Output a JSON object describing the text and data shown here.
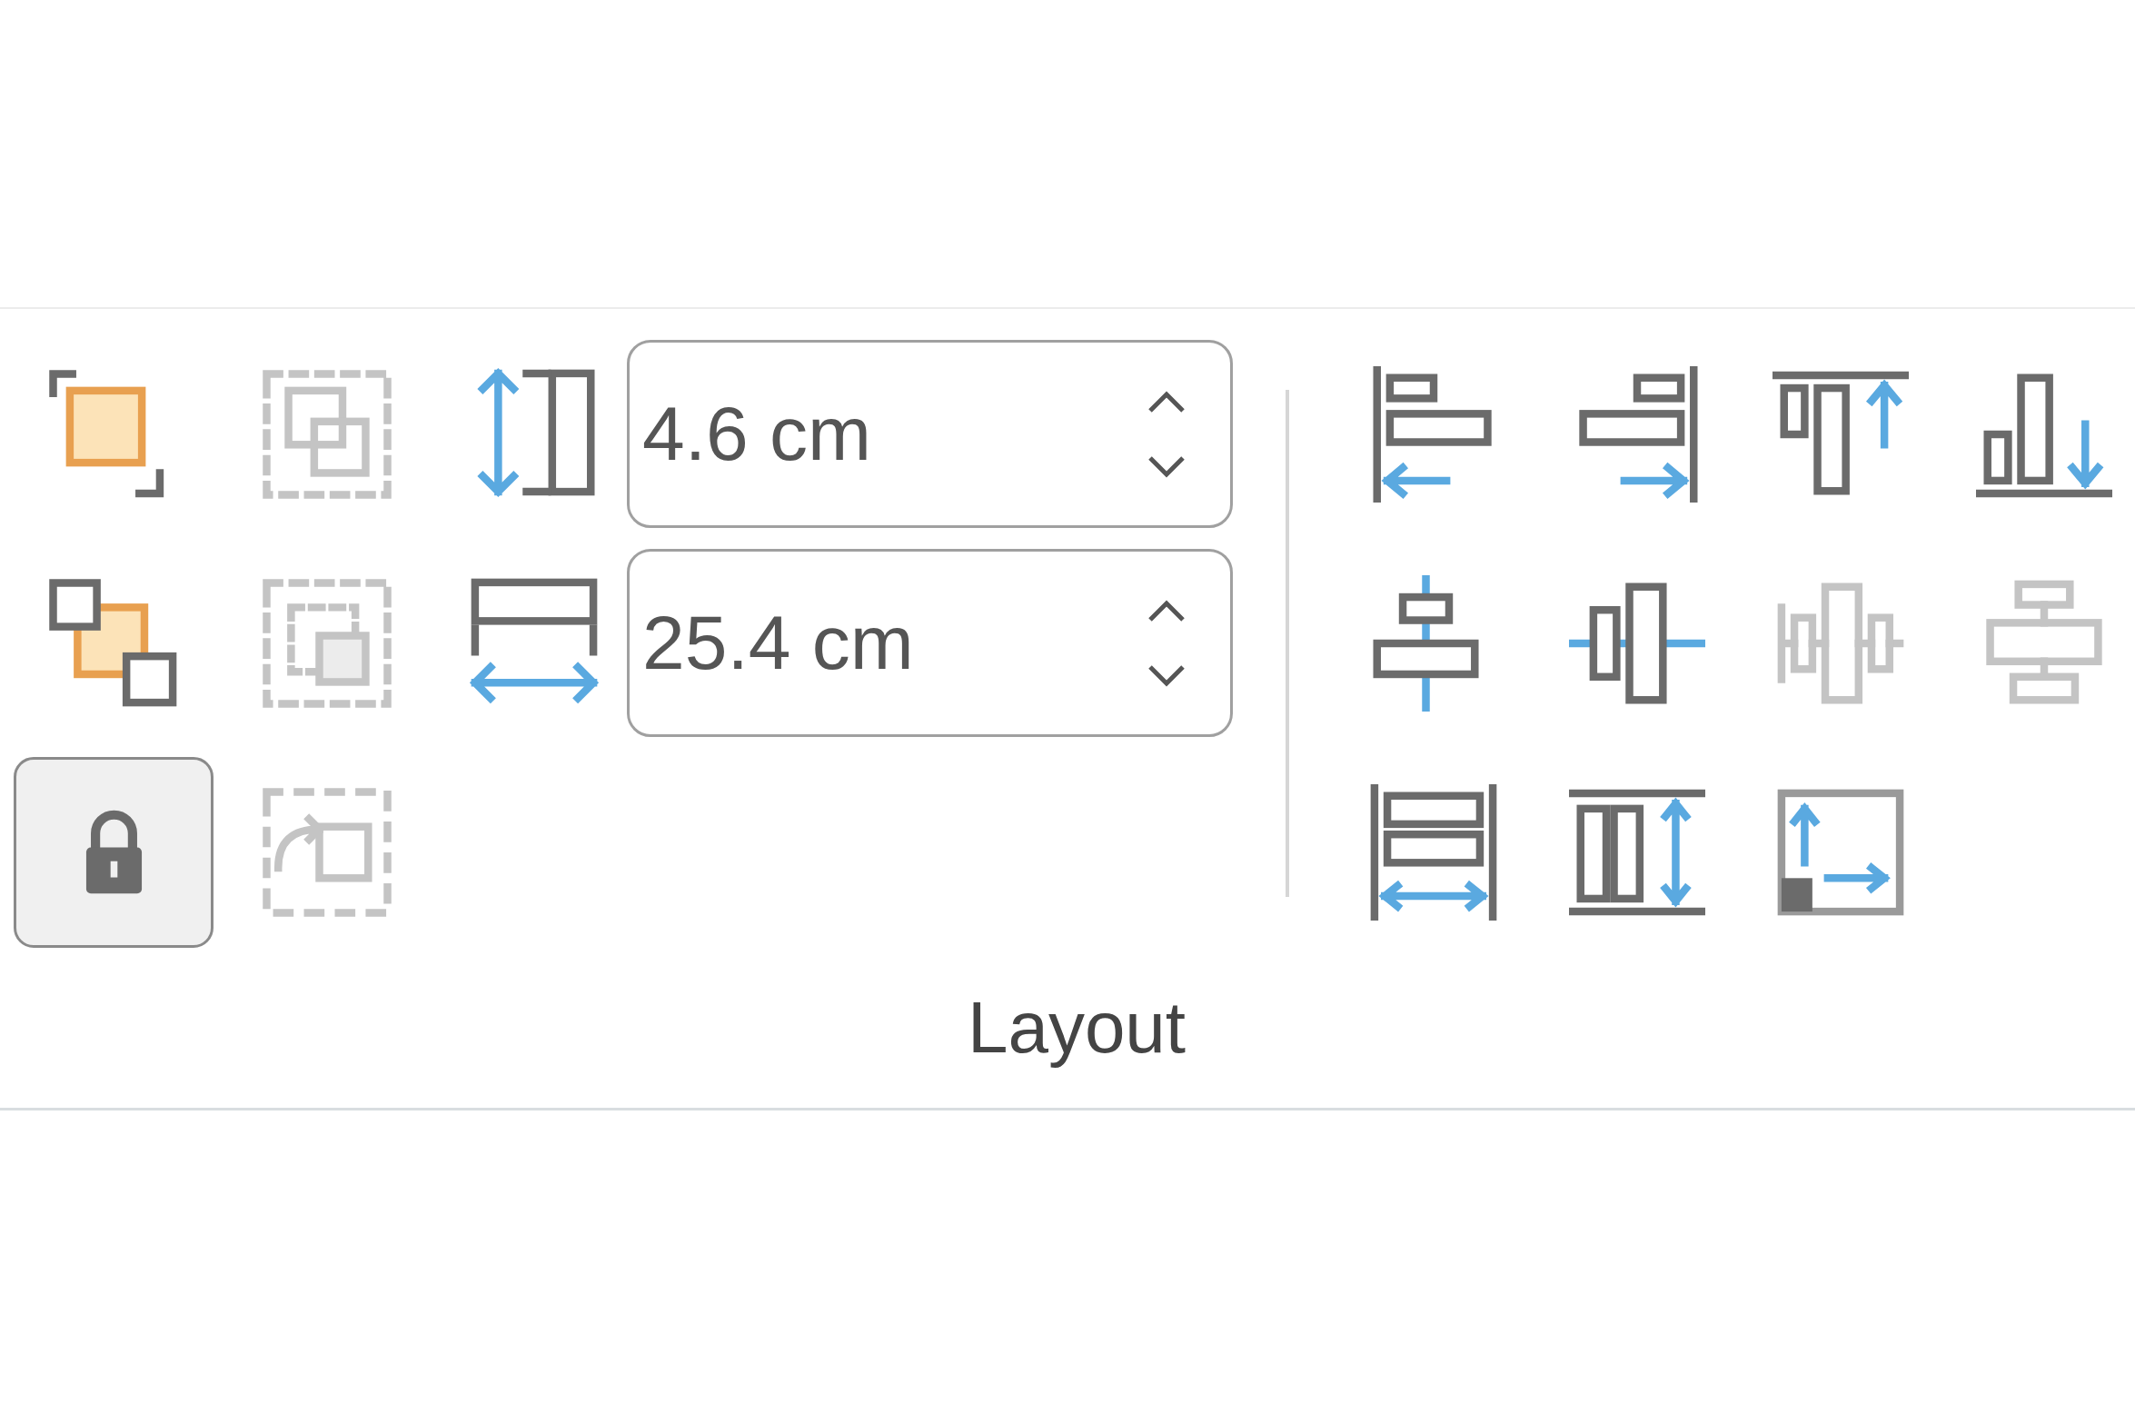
{
  "arrange": [
    {
      "kind": "bring-forward",
      "disabled": false,
      "pressed": false
    },
    {
      "kind": "group",
      "disabled": true,
      "pressed": false
    },
    {
      "kind": "send-backward",
      "disabled": false,
      "pressed": false
    },
    {
      "kind": "ungroup",
      "disabled": true,
      "pressed": false
    },
    {
      "kind": "lock",
      "disabled": false,
      "pressed": true
    },
    {
      "kind": "regroup",
      "disabled": true,
      "pressed": false
    }
  ],
  "size": [
    {
      "kind": "height",
      "value": "4.6 cm"
    },
    {
      "kind": "width",
      "value": "25.4 cm"
    }
  ],
  "align": [
    {
      "kind": "align-left",
      "disabled": false
    },
    {
      "kind": "align-right",
      "disabled": false
    },
    {
      "kind": "align-top",
      "disabled": false
    },
    {
      "kind": "align-bottom",
      "disabled": false
    },
    {
      "kind": "align-center",
      "disabled": false
    },
    {
      "kind": "align-middle",
      "disabled": false
    },
    {
      "kind": "distribute-middle",
      "disabled": true
    },
    {
      "kind": "distribute-center",
      "disabled": true
    },
    {
      "kind": "distribute-horizontal",
      "disabled": false
    },
    {
      "kind": "distribute-vertical",
      "disabled": false
    },
    {
      "kind": "position",
      "disabled": false
    }
  ],
  "group_label": "Layout"
}
